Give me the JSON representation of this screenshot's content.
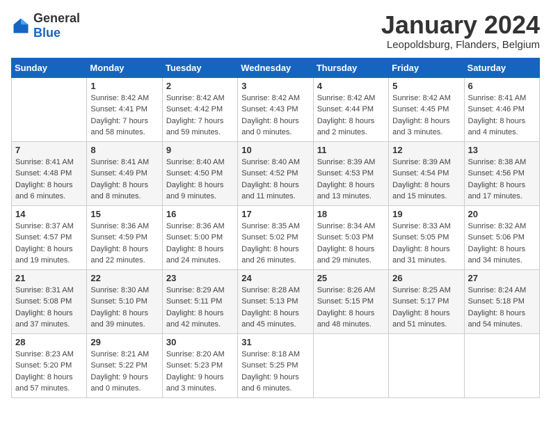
{
  "logo": {
    "general": "General",
    "blue": "Blue"
  },
  "title": "January 2024",
  "subtitle": "Leopoldsburg, Flanders, Belgium",
  "days_of_week": [
    "Sunday",
    "Monday",
    "Tuesday",
    "Wednesday",
    "Thursday",
    "Friday",
    "Saturday"
  ],
  "weeks": [
    [
      {
        "day": "",
        "info": ""
      },
      {
        "day": "1",
        "info": "Sunrise: 8:42 AM\nSunset: 4:41 PM\nDaylight: 7 hours\nand 58 minutes."
      },
      {
        "day": "2",
        "info": "Sunrise: 8:42 AM\nSunset: 4:42 PM\nDaylight: 7 hours\nand 59 minutes."
      },
      {
        "day": "3",
        "info": "Sunrise: 8:42 AM\nSunset: 4:43 PM\nDaylight: 8 hours\nand 0 minutes."
      },
      {
        "day": "4",
        "info": "Sunrise: 8:42 AM\nSunset: 4:44 PM\nDaylight: 8 hours\nand 2 minutes."
      },
      {
        "day": "5",
        "info": "Sunrise: 8:42 AM\nSunset: 4:45 PM\nDaylight: 8 hours\nand 3 minutes."
      },
      {
        "day": "6",
        "info": "Sunrise: 8:41 AM\nSunset: 4:46 PM\nDaylight: 8 hours\nand 4 minutes."
      }
    ],
    [
      {
        "day": "7",
        "info": "Sunrise: 8:41 AM\nSunset: 4:48 PM\nDaylight: 8 hours\nand 6 minutes."
      },
      {
        "day": "8",
        "info": "Sunrise: 8:41 AM\nSunset: 4:49 PM\nDaylight: 8 hours\nand 8 minutes."
      },
      {
        "day": "9",
        "info": "Sunrise: 8:40 AM\nSunset: 4:50 PM\nDaylight: 8 hours\nand 9 minutes."
      },
      {
        "day": "10",
        "info": "Sunrise: 8:40 AM\nSunset: 4:52 PM\nDaylight: 8 hours\nand 11 minutes."
      },
      {
        "day": "11",
        "info": "Sunrise: 8:39 AM\nSunset: 4:53 PM\nDaylight: 8 hours\nand 13 minutes."
      },
      {
        "day": "12",
        "info": "Sunrise: 8:39 AM\nSunset: 4:54 PM\nDaylight: 8 hours\nand 15 minutes."
      },
      {
        "day": "13",
        "info": "Sunrise: 8:38 AM\nSunset: 4:56 PM\nDaylight: 8 hours\nand 17 minutes."
      }
    ],
    [
      {
        "day": "14",
        "info": "Sunrise: 8:37 AM\nSunset: 4:57 PM\nDaylight: 8 hours\nand 19 minutes."
      },
      {
        "day": "15",
        "info": "Sunrise: 8:36 AM\nSunset: 4:59 PM\nDaylight: 8 hours\nand 22 minutes."
      },
      {
        "day": "16",
        "info": "Sunrise: 8:36 AM\nSunset: 5:00 PM\nDaylight: 8 hours\nand 24 minutes."
      },
      {
        "day": "17",
        "info": "Sunrise: 8:35 AM\nSunset: 5:02 PM\nDaylight: 8 hours\nand 26 minutes."
      },
      {
        "day": "18",
        "info": "Sunrise: 8:34 AM\nSunset: 5:03 PM\nDaylight: 8 hours\nand 29 minutes."
      },
      {
        "day": "19",
        "info": "Sunrise: 8:33 AM\nSunset: 5:05 PM\nDaylight: 8 hours\nand 31 minutes."
      },
      {
        "day": "20",
        "info": "Sunrise: 8:32 AM\nSunset: 5:06 PM\nDaylight: 8 hours\nand 34 minutes."
      }
    ],
    [
      {
        "day": "21",
        "info": "Sunrise: 8:31 AM\nSunset: 5:08 PM\nDaylight: 8 hours\nand 37 minutes."
      },
      {
        "day": "22",
        "info": "Sunrise: 8:30 AM\nSunset: 5:10 PM\nDaylight: 8 hours\nand 39 minutes."
      },
      {
        "day": "23",
        "info": "Sunrise: 8:29 AM\nSunset: 5:11 PM\nDaylight: 8 hours\nand 42 minutes."
      },
      {
        "day": "24",
        "info": "Sunrise: 8:28 AM\nSunset: 5:13 PM\nDaylight: 8 hours\nand 45 minutes."
      },
      {
        "day": "25",
        "info": "Sunrise: 8:26 AM\nSunset: 5:15 PM\nDaylight: 8 hours\nand 48 minutes."
      },
      {
        "day": "26",
        "info": "Sunrise: 8:25 AM\nSunset: 5:17 PM\nDaylight: 8 hours\nand 51 minutes."
      },
      {
        "day": "27",
        "info": "Sunrise: 8:24 AM\nSunset: 5:18 PM\nDaylight: 8 hours\nand 54 minutes."
      }
    ],
    [
      {
        "day": "28",
        "info": "Sunrise: 8:23 AM\nSunset: 5:20 PM\nDaylight: 8 hours\nand 57 minutes."
      },
      {
        "day": "29",
        "info": "Sunrise: 8:21 AM\nSunset: 5:22 PM\nDaylight: 9 hours\nand 0 minutes."
      },
      {
        "day": "30",
        "info": "Sunrise: 8:20 AM\nSunset: 5:23 PM\nDaylight: 9 hours\nand 3 minutes."
      },
      {
        "day": "31",
        "info": "Sunrise: 8:18 AM\nSunset: 5:25 PM\nDaylight: 9 hours\nand 6 minutes."
      },
      {
        "day": "",
        "info": ""
      },
      {
        "day": "",
        "info": ""
      },
      {
        "day": "",
        "info": ""
      }
    ]
  ]
}
